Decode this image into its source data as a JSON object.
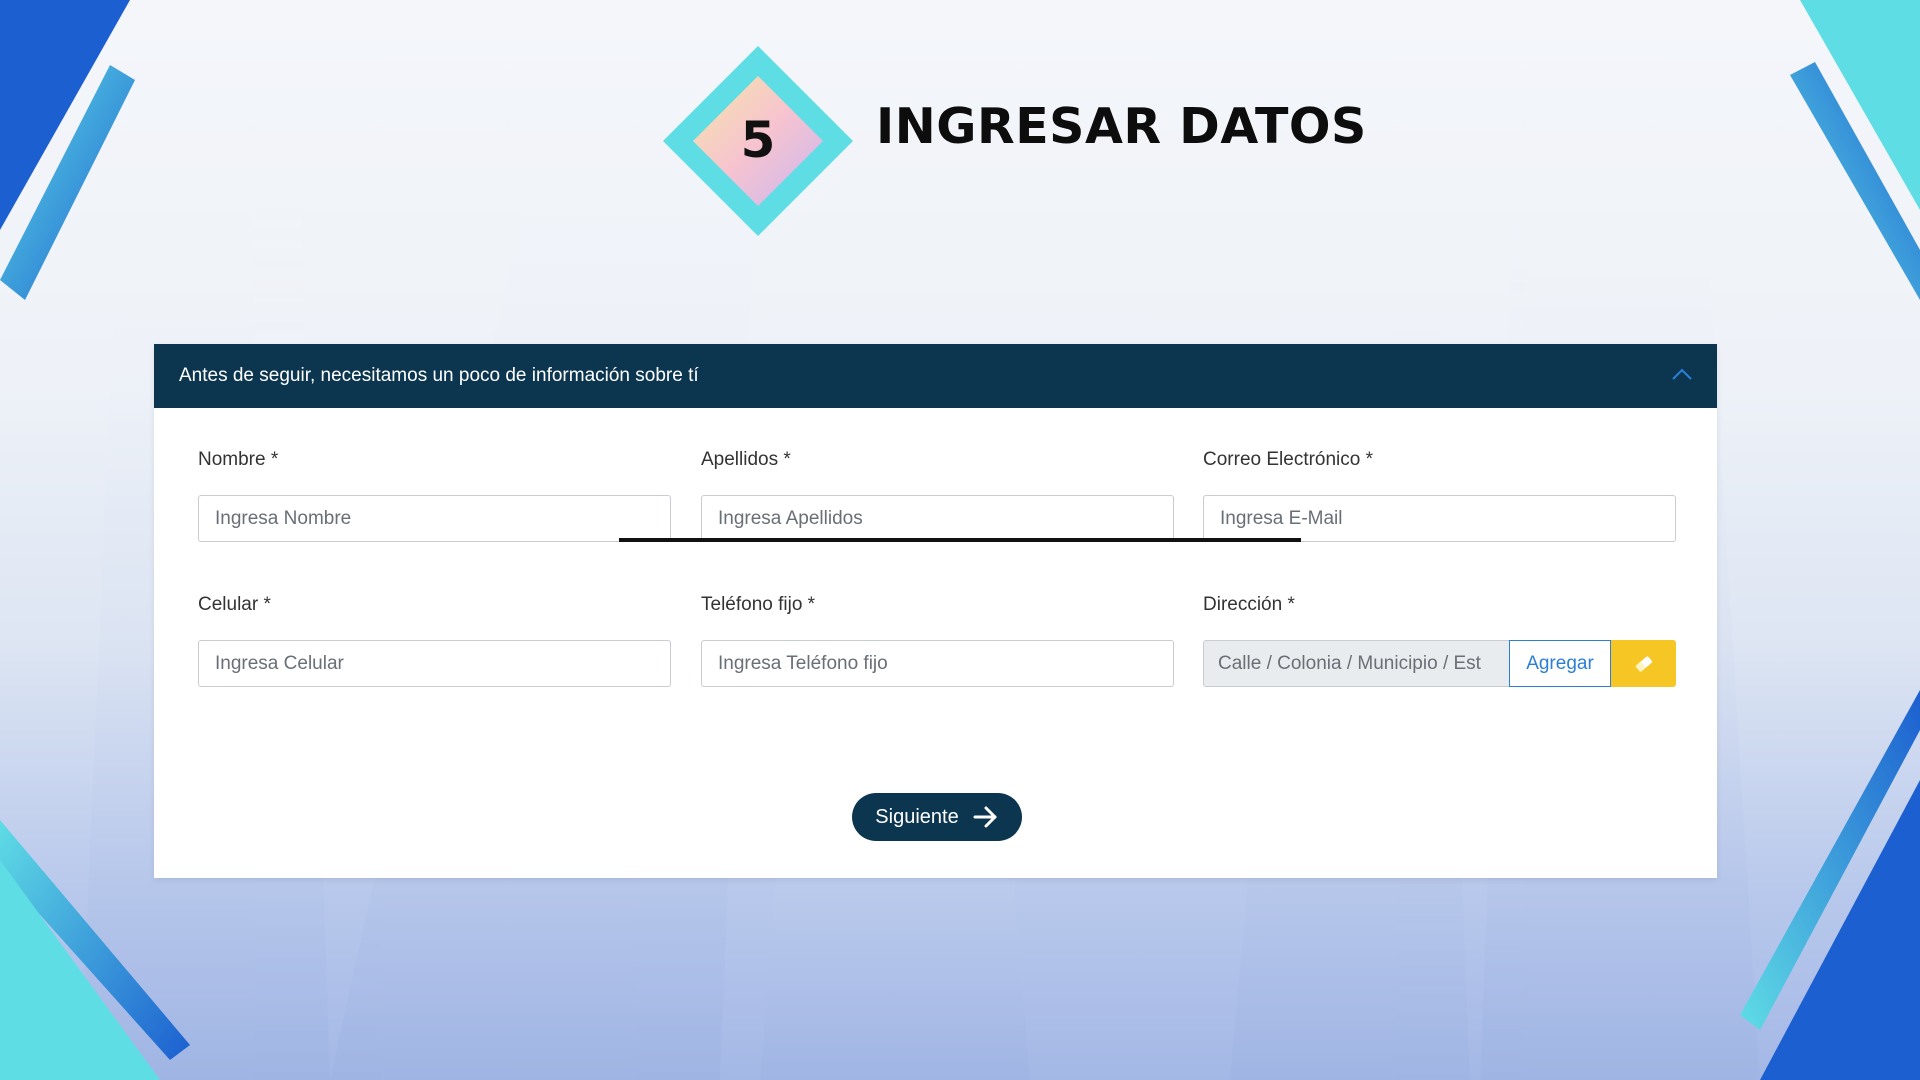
{
  "slide": {
    "step_number": "5",
    "title": "INGRESAR DATOS"
  },
  "form": {
    "header_text": "Antes de seguir, necesitamos un poco de información sobre tí",
    "fields": [
      {
        "label": "Nombre *",
        "placeholder": "Ingresa Nombre"
      },
      {
        "label": "Apellidos *",
        "placeholder": "Ingresa Apellidos"
      },
      {
        "label": "Correo Electrónico *",
        "placeholder": "Ingresa E-Mail"
      },
      {
        "label": "Celular *",
        "placeholder": "Ingresa Celular"
      },
      {
        "label": "Teléfono fijo *",
        "placeholder": "Ingresa Teléfono fijo"
      }
    ],
    "address": {
      "label": "Dirección *",
      "placeholder": "Calle / Colonia / Municipio / Est",
      "add_label": "Agregar"
    },
    "next_label": "Siguiente"
  },
  "colors": {
    "header_bg": "#0c3650",
    "accent_cyan": "#5fdde5",
    "accent_blue": "#1c5fd0",
    "clear_button": "#f6c624",
    "link_blue": "#2b7fd6"
  },
  "icons": [
    "chevron-up-icon",
    "eraser-icon",
    "arrow-right-icon"
  ]
}
